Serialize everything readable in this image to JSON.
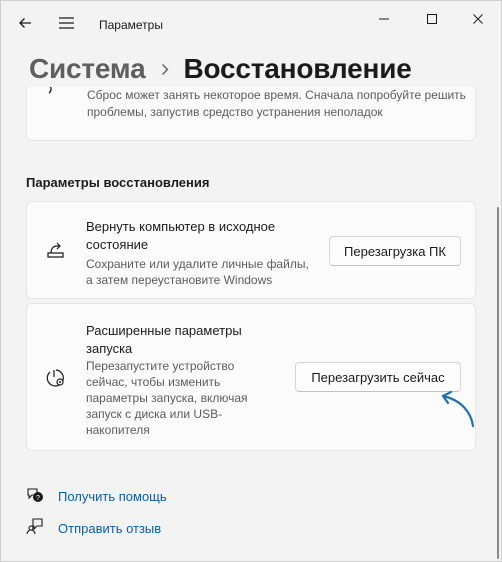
{
  "window": {
    "app_title": "Параметры",
    "back_icon": "back-arrow-icon",
    "menu_icon": "hamburger-menu-icon",
    "controls": [
      "minimize-icon",
      "maximize-icon",
      "close-icon"
    ]
  },
  "header": {
    "parent": "Система",
    "current": "Восстановление"
  },
  "top_card": {
    "description": "Сброс может занять некоторое время. Сначала попробуйте решить проблемы, запустив средство устранения неполадок"
  },
  "section": {
    "title": "Параметры восстановления"
  },
  "reset_card": {
    "icon": "reset-pc-icon",
    "title": "Вернуть компьютер в исходное состояние",
    "subtitle": "Сохраните или удалите личные файлы, а затем переустановите Windows",
    "button": "Перезагрузка ПК"
  },
  "advanced_card": {
    "icon": "advanced-startup-icon",
    "title": "Расширенные параметры запуска",
    "subtitle": "Перезапустите устройство сейчас, чтобы изменить параметры запуска, включая запуск с диска или USB-накопителя",
    "button": "Перезагрузить сейчас",
    "annotation_color": "#1f6fb0"
  },
  "links": {
    "help": "Получить помощь",
    "feedback": "Отправить отзыв"
  },
  "colors": {
    "accent_link": "#0a5ea8",
    "background": "#f3f3f3",
    "card": "#fbfbfb"
  }
}
